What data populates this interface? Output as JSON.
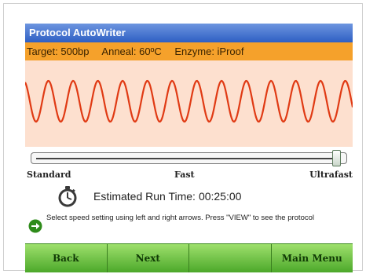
{
  "app": {
    "title": "Protocol AutoWriter"
  },
  "status": {
    "target": "Target: 500bp",
    "anneal": "Anneal: 60ºC",
    "enzyme": "Enzyme: iProof"
  },
  "speed": {
    "labels": [
      "Standard",
      "Fast",
      "Ultrafast"
    ],
    "selected": "Ultrafast",
    "level": 1.0
  },
  "runtime": {
    "label": "Estimated Run Time:",
    "value": "00:25:00"
  },
  "instruction": "Select speed setting using left and right arrows. Press \"VIEW\" to see the protocol",
  "softkeys": [
    "Back",
    "Next",
    "",
    "Main Menu"
  ],
  "colors": {
    "title_bar": "#2e5fc3",
    "status_bar": "#f5a12b",
    "wave_panel": "#fde0cf",
    "wave_line": "#e03a14",
    "softkey_bar": "#5fb83a"
  },
  "icons": {
    "runtime": "stopwatch-icon",
    "instruction": "green-arrow-icon"
  }
}
